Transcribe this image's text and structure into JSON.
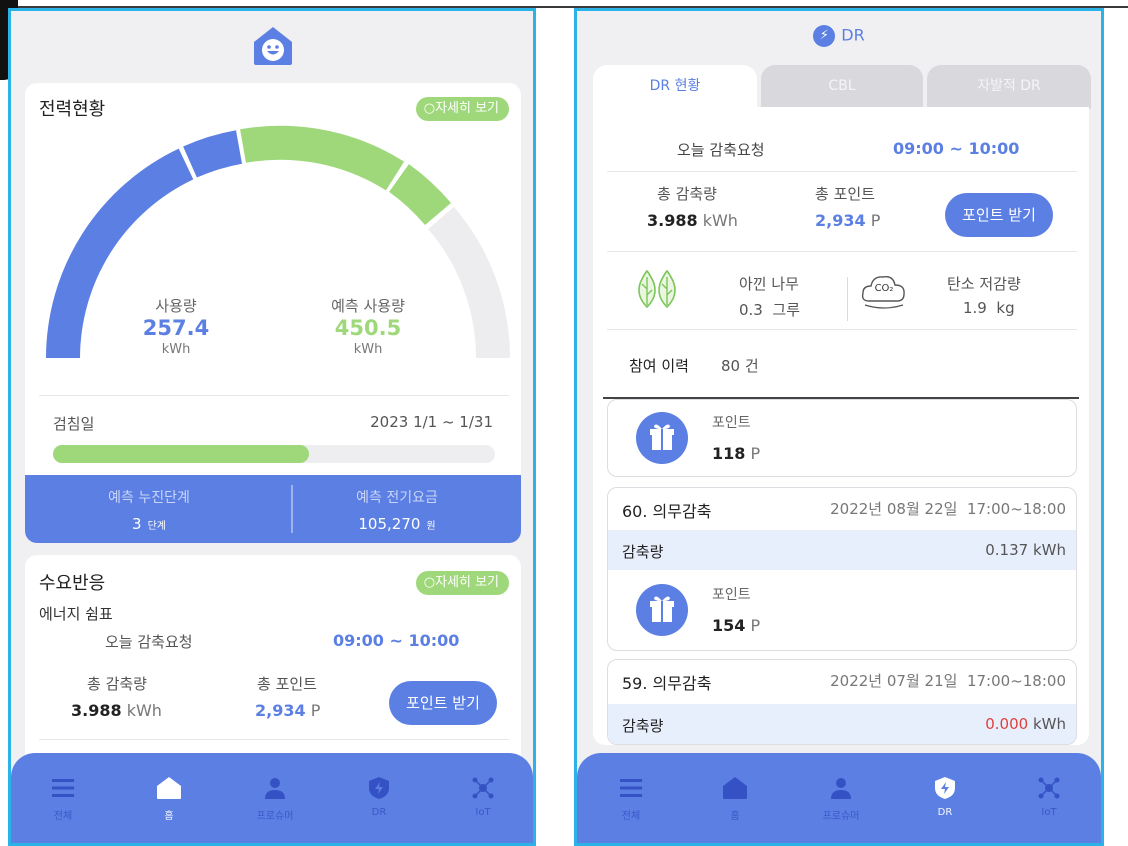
{
  "left": {
    "power_card": {
      "title": "전력현황",
      "detail_button": "자세히 보기",
      "usage": {
        "label": "사용량",
        "value": "257.4",
        "unit": "kWh"
      },
      "forecast": {
        "label": "예측 사용량",
        "value": "450.5",
        "unit": "kWh"
      },
      "meter_label": "검침일",
      "meter_period": "2023 1/1 ~ 1/31",
      "meter_progress": 0.58,
      "forecast_stage_label": "예측 누진단계",
      "forecast_stage_value": "3",
      "forecast_stage_unit": "단계",
      "forecast_bill_label": "예측 전기요금",
      "forecast_bill_value": "105,270",
      "forecast_bill_unit": "원"
    },
    "dr_card": {
      "title": "수요반응",
      "detail_button": "자세히 보기",
      "subtitle": "에너지 쉼표",
      "today_request_label": "오늘 감축요청",
      "today_request_time": "09:00 ~ 10:00",
      "total_reduction_label": "총 감축량",
      "total_reduction_value": "3.988",
      "total_reduction_unit": "kWh",
      "total_points_label": "총 포인트",
      "total_points_value": "2,934",
      "total_points_unit": "P",
      "get_points_button": "포인트 받기"
    },
    "nav": [
      {
        "label": "전체",
        "icon": "menu-icon"
      },
      {
        "label": "홈",
        "icon": "home-icon"
      },
      {
        "label": "프로슈머",
        "icon": "person-icon"
      },
      {
        "label": "DR",
        "icon": "dr-shield-icon"
      },
      {
        "label": "IoT",
        "icon": "iot-network-icon"
      }
    ],
    "nav_active": "홈"
  },
  "right": {
    "header": "DR",
    "tabs": [
      "DR 현황",
      "CBL",
      "자발적 DR"
    ],
    "active_tab": "DR 현황",
    "today_request_label": "오늘 감축요청",
    "today_request_time": "09:00 ~ 10:00",
    "total_reduction_label": "총 감축량",
    "total_reduction_value": "3.988",
    "total_reduction_unit": "kWh",
    "total_points_label": "총 포인트",
    "total_points_value": "2,934",
    "total_points_unit": "P",
    "get_points_button": "포인트 받기",
    "saved_trees_label": "아낀 나무",
    "saved_trees_value": "0.3",
    "saved_trees_unit": "그루",
    "carbon_label": "탄소 저감량",
    "carbon_value": "1.9",
    "carbon_unit": "kg",
    "co2_text": "CO₂",
    "history_label": "참여 이력",
    "history_count": "80 건",
    "entries": [
      {
        "points_label": "포인트",
        "points_value": "118",
        "points_unit": "P"
      },
      {
        "title": "60. 의무감축",
        "date": "2022년 08월 22일",
        "time": "17:00~18:00",
        "reduction_label": "감축량",
        "reduction_value": "0.137",
        "reduction_unit": "kWh",
        "points_label": "포인트",
        "points_value": "154",
        "points_unit": "P"
      },
      {
        "title": "59. 의무감축",
        "date": "2022년 07월 21일",
        "time": "17:00~18:00",
        "reduction_label": "감축량",
        "reduction_value": "0.000",
        "reduction_unit": "kWh"
      }
    ],
    "nav": [
      {
        "label": "전체",
        "icon": "menu-icon"
      },
      {
        "label": "홈",
        "icon": "home-icon"
      },
      {
        "label": "프로슈머",
        "icon": "person-icon"
      },
      {
        "label": "DR",
        "icon": "dr-bolt-icon"
      },
      {
        "label": "IoT",
        "icon": "iot-network-icon"
      }
    ],
    "nav_active": "DR"
  },
  "colors": {
    "primary_blue": "#5b7fe3",
    "accent_green": "#9fd87a",
    "frame_cyan": "#2bb3e8",
    "alert_red": "#e0413b"
  }
}
